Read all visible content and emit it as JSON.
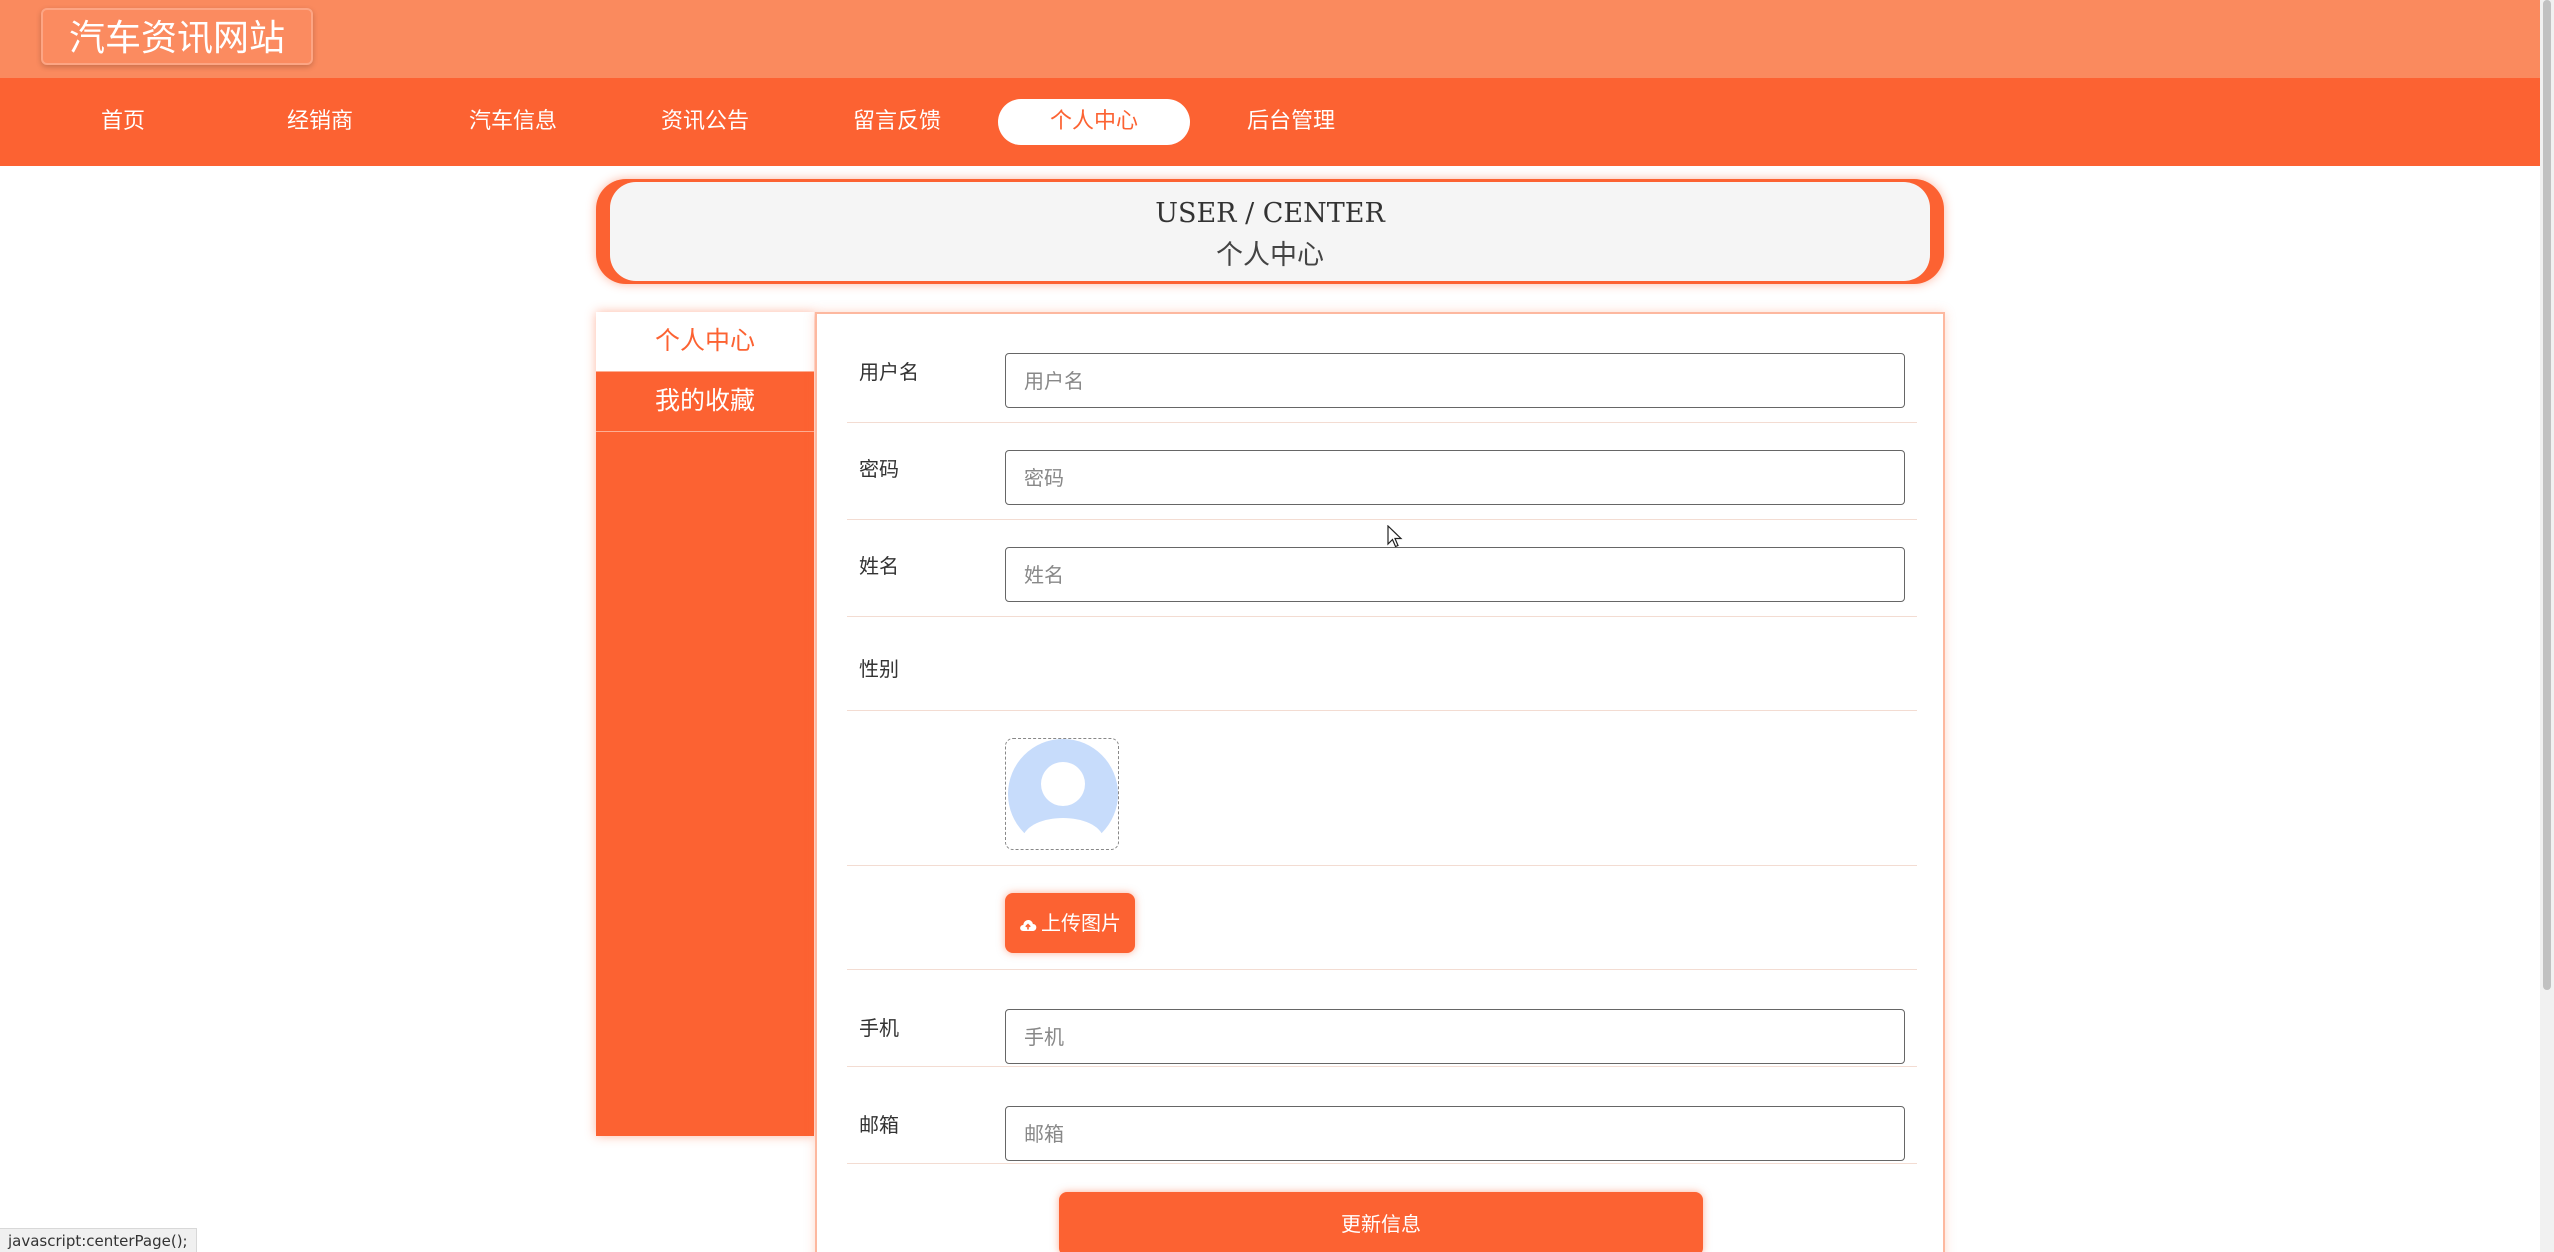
{
  "site": {
    "title": "汽车资讯网站"
  },
  "nav": {
    "items": [
      {
        "label": "首页"
      },
      {
        "label": "经销商"
      },
      {
        "label": "汽车信息"
      },
      {
        "label": "资讯公告"
      },
      {
        "label": "留言反馈"
      },
      {
        "label": "个人中心",
        "active": true
      },
      {
        "label": "后台管理"
      }
    ]
  },
  "banner": {
    "en": "USER / CENTER",
    "cn": "个人中心"
  },
  "sidebar": {
    "items": [
      {
        "label": "个人中心",
        "active": true
      },
      {
        "label": "我的收藏"
      }
    ]
  },
  "form": {
    "username": {
      "label": "用户名",
      "placeholder": "用户名",
      "value": ""
    },
    "password": {
      "label": "密码",
      "placeholder": "密码",
      "value": ""
    },
    "name": {
      "label": "姓名",
      "placeholder": "姓名",
      "value": ""
    },
    "gender": {
      "label": "性别"
    },
    "upload_label": "上传图片",
    "phone": {
      "label": "手机",
      "placeholder": "手机",
      "value": ""
    },
    "email": {
      "label": "邮箱",
      "placeholder": "邮箱",
      "value": ""
    },
    "submit_label": "更新信息"
  },
  "status_bar": {
    "text": "javascript:centerPage();"
  },
  "theme": {
    "primary": "#fc6232",
    "header": "#fa8a5e",
    "avatar": "#c7dcfb"
  }
}
